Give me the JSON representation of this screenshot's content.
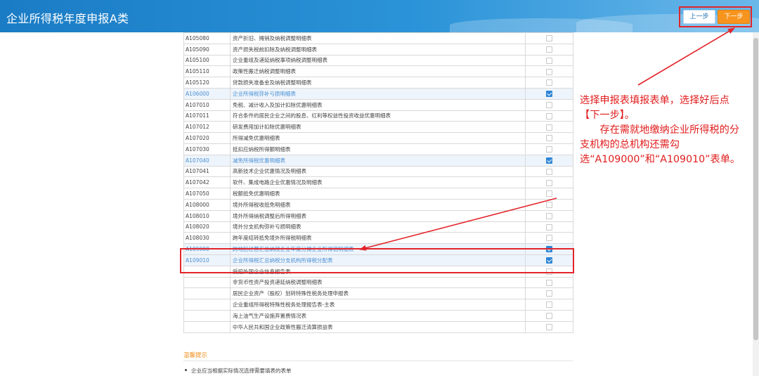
{
  "header": {
    "title": "企业所得税年度申报A类"
  },
  "nav": {
    "prev_label": "上一步",
    "next_label": "下一步"
  },
  "rows": [
    {
      "code": "A105080",
      "name": "资产折旧、摊销及纳税调整明细表",
      "checked": false,
      "selected": false
    },
    {
      "code": "A105090",
      "name": "资产损失税前扣除及纳税调整明细表",
      "checked": false,
      "selected": false
    },
    {
      "code": "A105100",
      "name": "企业重组及递延纳税事项纳税调整明细表",
      "checked": false,
      "selected": false
    },
    {
      "code": "A105110",
      "name": "政策性搬迁纳税调整明细表",
      "checked": false,
      "selected": false
    },
    {
      "code": "A105120",
      "name": "贷款损失准备金及纳税调整明细表",
      "checked": false,
      "selected": false
    },
    {
      "code": "A106000",
      "name": "企业所得税弥补亏损明细表",
      "checked": true,
      "selected": true
    },
    {
      "code": "A107010",
      "name": "免税、减计收入及加计扣除优惠明细表",
      "checked": false,
      "selected": false
    },
    {
      "code": "A107011",
      "name": "符合条件的居民企业之间的股息、红利等权益性投资收益优惠明细表",
      "checked": false,
      "selected": false
    },
    {
      "code": "A107012",
      "name": "研发费用加计扣除优惠明细表",
      "checked": false,
      "selected": false
    },
    {
      "code": "A107020",
      "name": "所得减免优惠明细表",
      "checked": false,
      "selected": false
    },
    {
      "code": "A107030",
      "name": "抵扣应纳税所得额明细表",
      "checked": false,
      "selected": false
    },
    {
      "code": "A107040",
      "name": "减免所得税优惠明细表",
      "checked": true,
      "selected": true
    },
    {
      "code": "A107041",
      "name": "高新技术企业优惠情况及明细表",
      "checked": false,
      "selected": false
    },
    {
      "code": "A107042",
      "name": "软件、集成电路企业优惠情况及明细表",
      "checked": false,
      "selected": false
    },
    {
      "code": "A107050",
      "name": "税额抵免优惠明细表",
      "checked": false,
      "selected": false
    },
    {
      "code": "A108000",
      "name": "境外所得税收抵免明细表",
      "checked": false,
      "selected": false
    },
    {
      "code": "A108010",
      "name": "境外所得纳税调整后所得明细表",
      "checked": false,
      "selected": false
    },
    {
      "code": "A108020",
      "name": "境外分支机构弥补亏损明细表",
      "checked": false,
      "selected": false
    },
    {
      "code": "A108030",
      "name": "跨年度结转抵免境外所得税明细表",
      "checked": false,
      "selected": false
    },
    {
      "code": "A109000",
      "name": "跨地区经营汇总纳税企业年度分摊企业所得税明细表",
      "checked": true,
      "selected": true
    },
    {
      "code": "A109010",
      "name": "企业所得税汇总纳税分支机构所得税分配表",
      "checked": true,
      "selected": true
    },
    {
      "code": "",
      "name": "受控外国企业信息报告表",
      "checked": false,
      "selected": false
    },
    {
      "code": "",
      "name": "非货币性资产投资递延纳税调整明细表",
      "checked": false,
      "selected": false
    },
    {
      "code": "",
      "name": "居民企业资产（股权）划转特殊性税务处理申报表",
      "checked": false,
      "selected": false
    },
    {
      "code": "",
      "name": "企业重组所得税特殊性税务处理报告表-主表",
      "checked": false,
      "selected": false
    },
    {
      "code": "",
      "name": "海上油气生产设施弃置费情况表",
      "checked": false,
      "selected": false
    },
    {
      "code": "",
      "name": "中华人民共和国企业政策性搬迁清算损益表",
      "checked": false,
      "selected": false
    }
  ],
  "annotation": {
    "line1": "选择申报表填报表单，选择好后点【下一步】。",
    "line2": "存在需就地缴纳企业所得税的分支机构的总机构还需勾选“A109000”和“A109010”表单。"
  },
  "tips": {
    "title": "温馨提示",
    "text": "企业应当根据实际情况选择需要填表的表单"
  },
  "colors": {
    "accent": "#1a7cc5",
    "annotation_red": "#e11d1d",
    "next_orange": "#f7941d",
    "checkbox_blue": "#2f86d6"
  }
}
